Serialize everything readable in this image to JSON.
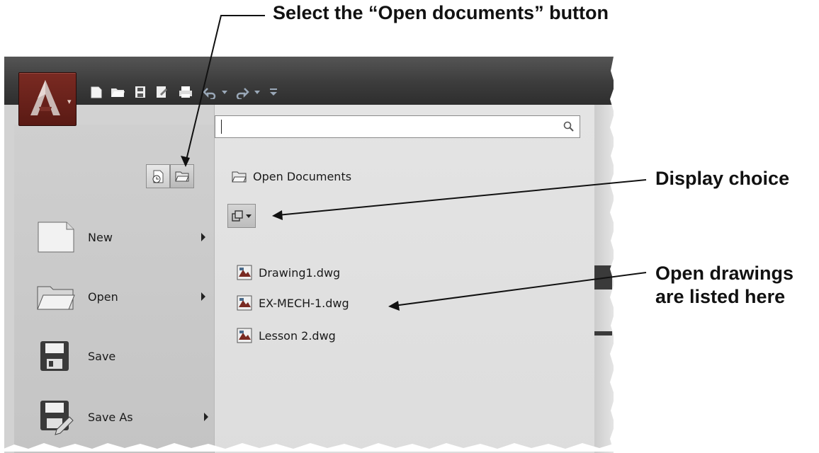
{
  "annotations": {
    "select_open_documents": "Select the “Open documents” button",
    "display_choice": "Display choice",
    "open_drawings_line1": "Open drawings",
    "open_drawings_line2": "are listed here"
  },
  "search": {
    "value": ""
  },
  "open_docs_header": "Open Documents",
  "documents": [
    {
      "name": "Drawing1.dwg"
    },
    {
      "name": "EX-MECH-1.dwg"
    },
    {
      "name": "Lesson 2.dwg"
    }
  ],
  "menu": {
    "new": "New",
    "open": "Open",
    "save": "Save",
    "save_as": "Save As"
  },
  "colors": {
    "app_button": "#6b2219",
    "titlebar": "#3c3c3c",
    "menu_pane": "#cfcfcf",
    "list_pane": "#e0e0e0"
  }
}
